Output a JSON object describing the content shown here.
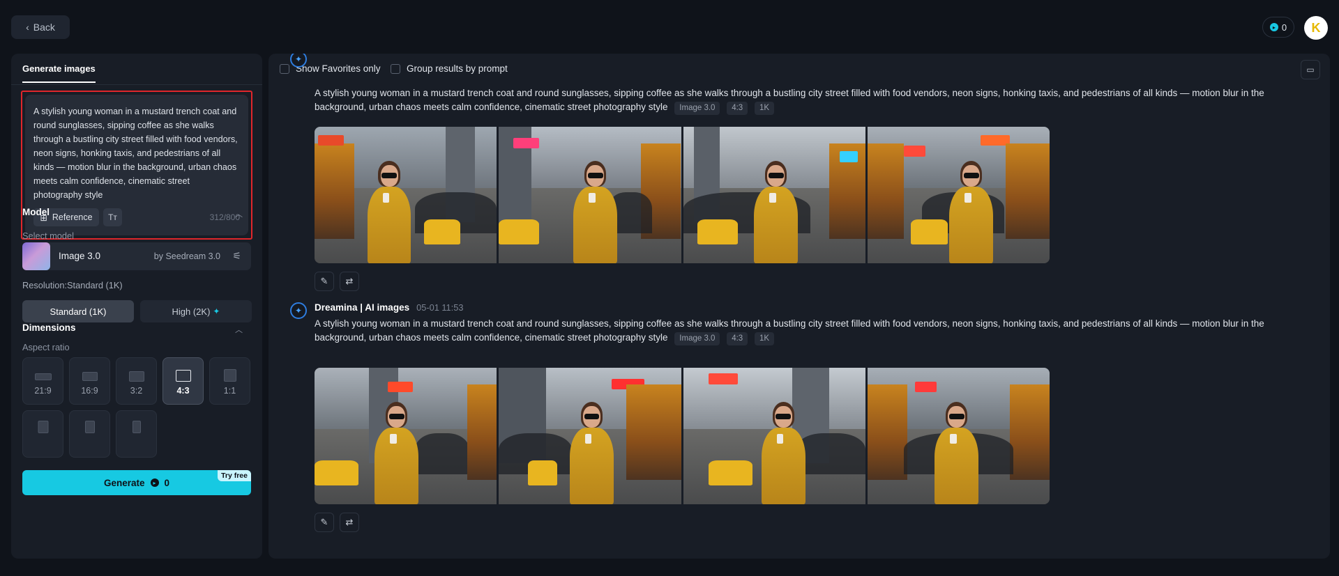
{
  "topbar": {
    "back_label": "Back",
    "credits": "0",
    "avatar_letter": "K"
  },
  "left_panel": {
    "tab_label": "Generate images",
    "prompt_text": "A stylish young woman in a mustard trench coat and round sunglasses, sipping coffee as she walks through a bustling city street filled with food vendors, neon signs, honking taxis, and pedestrians of all kinds — motion blur in the background, urban chaos meets calm confidence, cinematic street photography style",
    "reference_label": "Reference",
    "char_count": "312/800",
    "model_section": "Model",
    "select_model_label": "Select model",
    "model_name": "Image 3.0",
    "model_by": "by Seedream 3.0",
    "resolution_label": "Resolution:Standard (1K)",
    "resolution_options": [
      "Standard (1K)",
      "High (2K)"
    ],
    "dimensions_section": "Dimensions",
    "aspect_ratio_label": "Aspect ratio",
    "aspect_ratios": [
      "21:9",
      "16:9",
      "3:2",
      "4:3",
      "1:1"
    ],
    "aspect_selected": "4:3",
    "generate_label": "Generate",
    "generate_cost": "0",
    "try_free_label": "Try free"
  },
  "main_panel": {
    "filters": [
      "Show Favorites only",
      "Group results by prompt"
    ],
    "generations": [
      {
        "author": "",
        "time": "",
        "prompt": "A stylish young woman in a mustard trench coat and round sunglasses, sipping coffee as she walks through a bustling city street filled with food vendors, neon signs, honking taxis, and pedestrians of all kinds — motion blur in the background, urban chaos meets calm confidence, cinematic street photography style",
        "tags": [
          "Image 3.0",
          "4:3",
          "1K"
        ]
      },
      {
        "author": "Dreamina | AI images",
        "time": "05-01   11:53",
        "prompt": "A stylish young woman in a mustard trench coat and round sunglasses, sipping coffee as she walks through a bustling city street filled with food vendors, neon signs, honking taxis, and pedestrians of all kinds — motion blur in the background, urban chaos meets calm confidence, cinematic street photography style",
        "tags": [
          "Image 3.0",
          "4:3",
          "1K"
        ]
      }
    ]
  },
  "colors": {
    "accent": "#17c9e2",
    "highlight_border": "#e0262b",
    "coat": "#d4a321"
  }
}
